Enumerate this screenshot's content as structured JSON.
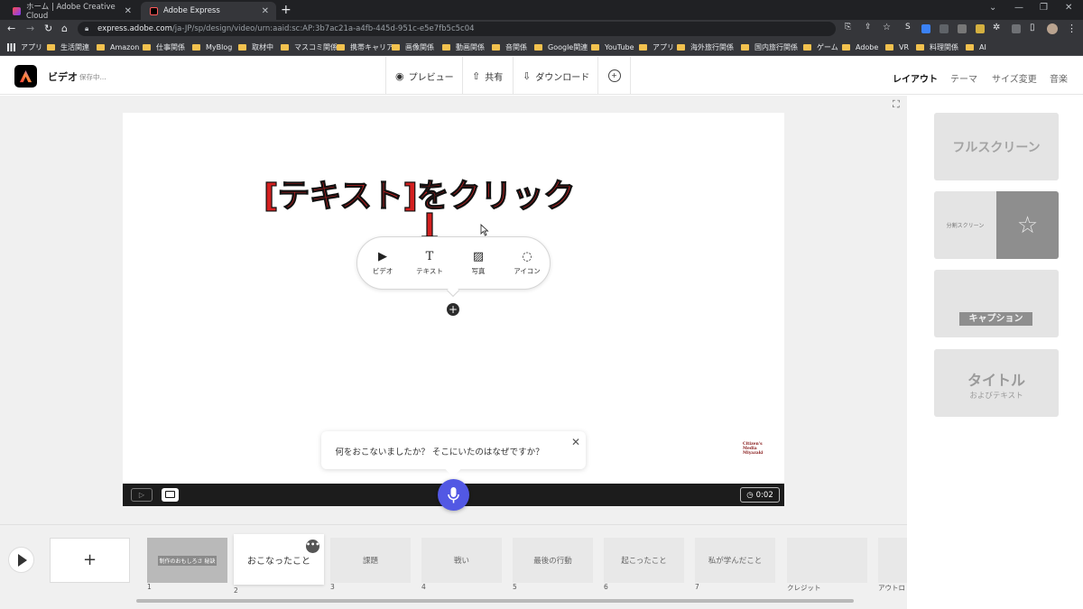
{
  "browser": {
    "tabs": [
      {
        "label": "ホーム | Adobe Creative Cloud",
        "active": false
      },
      {
        "label": "Adobe Express",
        "active": true
      }
    ],
    "url_host": "express.adobe.com",
    "url_path": "/ja-JP/sp/design/video/urn:aaid:sc:AP:3b7ac21a-a4fb-445d-951c-e5e7fb5c5c04",
    "bookmarks": [
      "アプリ",
      "生活関連",
      "Amazon",
      "仕事関係",
      "MyBlog",
      "取材中",
      "マスコミ関係",
      "携帯キャリア",
      "画像関係",
      "動画関係",
      "音関係",
      "Google関連",
      "YouTube",
      "アプリ",
      "海外旅行関係",
      "国内旅行関係",
      "ゲーム",
      "Adobe",
      "VR",
      "料理関係",
      "AI"
    ]
  },
  "header": {
    "doc_title": "ビデオ",
    "save_status": "保存中...",
    "preview_label": "プレビュー",
    "share_label": "共有",
    "download_label": "ダウンロード",
    "right_tabs": [
      "レイアウト",
      "テーマ",
      "サイズ変更",
      "音楽"
    ]
  },
  "stage": {
    "annotation": "[テキスト]をクリック",
    "insert_menu": [
      "ビデオ",
      "テキスト",
      "写真",
      "アイコン"
    ],
    "prompt": "何をおこないましたか？ そこにいたのはなぜですか？",
    "watermark": "Citizen's Media Miyazaki",
    "duration": "0:02"
  },
  "layouts": {
    "fullscreen": "フルスクリーン",
    "split": "分割スクリーン",
    "caption": "キャプション",
    "title_main": "タイトル",
    "title_sub": "およびテキスト"
  },
  "timeline": {
    "scene1_thumb_text": "制作のおもしろさ 秘訣",
    "scenes": [
      {
        "label": "おこなったこと",
        "num": "2"
      },
      {
        "label": "課題",
        "num": "3"
      },
      {
        "label": "戦い",
        "num": "4"
      },
      {
        "label": "最後の行動",
        "num": "5"
      },
      {
        "label": "起こったこと",
        "num": "6"
      },
      {
        "label": "私が学んだこと",
        "num": "7"
      },
      {
        "label": "",
        "num": "クレジット"
      },
      {
        "label": "",
        "num": "アウトロ"
      }
    ],
    "scene1_num": "1"
  },
  "colors": {
    "accent_mic": "#5258e4",
    "annotation_red": "#d42020"
  }
}
